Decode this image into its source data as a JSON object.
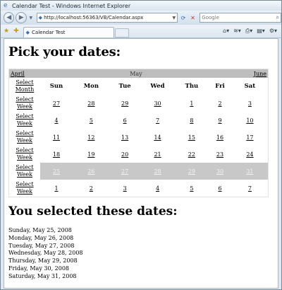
{
  "window": {
    "title": "Calendar Test - Windows Internet Explorer",
    "url": "http://localhost:56363/VB/Calendar.aspx",
    "search_placeholder": "Google",
    "tab_title": "Calendar Test"
  },
  "page": {
    "heading": "Pick your dates:",
    "selected_heading": "You selected these dates:"
  },
  "calendar": {
    "prev_label": "April",
    "month_label": "May",
    "next_label": "June",
    "select_month_label": "Select Month",
    "select_week_label": "Select Week",
    "day_headers": [
      "Sun",
      "Mon",
      "Tue",
      "Wed",
      "Thu",
      "Fri",
      "Sat"
    ],
    "selected_week_index": 4,
    "weeks": [
      [
        "27",
        "28",
        "29",
        "30",
        "1",
        "2",
        "3"
      ],
      [
        "4",
        "5",
        "6",
        "7",
        "8",
        "9",
        "10"
      ],
      [
        "11",
        "12",
        "13",
        "14",
        "15",
        "16",
        "17"
      ],
      [
        "18",
        "19",
        "20",
        "21",
        "22",
        "23",
        "24"
      ],
      [
        "25",
        "26",
        "27",
        "28",
        "29",
        "30",
        "31"
      ],
      [
        "1",
        "2",
        "3",
        "4",
        "5",
        "6",
        "7"
      ]
    ]
  },
  "selected_dates": [
    "Sunday, May 25, 2008",
    "Monday, May 26, 2008",
    "Tuesday, May 27, 2008",
    "Wednesday, May 28, 2008",
    "Thursday, May 29, 2008",
    "Friday, May 30, 2008",
    "Saturday, May 31, 2008"
  ]
}
